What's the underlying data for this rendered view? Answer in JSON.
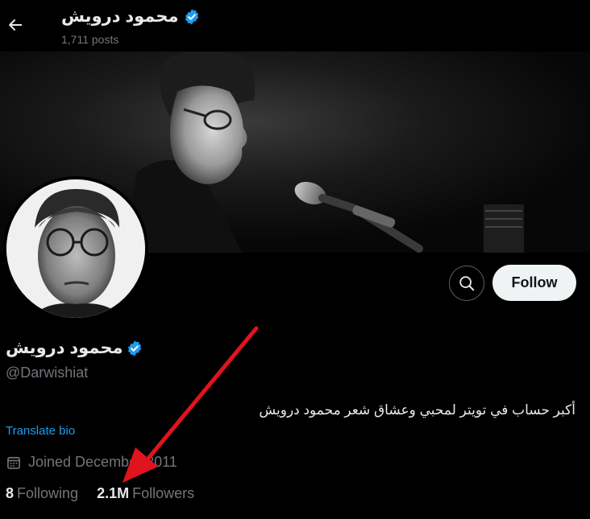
{
  "header": {
    "title": "محمود درويش",
    "posts": "1,711 posts"
  },
  "profile": {
    "name": "محمود درويش",
    "handle": "@Darwishiat",
    "bio": "أكبر حساب في تويتر لمحبي وعشاق شعر محمود درويش",
    "translate_label": "Translate bio",
    "joined": "Joined December 2011",
    "following_count": "8",
    "following_label": "Following",
    "followers_count": "2.1M",
    "followers_label": "Followers"
  },
  "actions": {
    "follow_label": "Follow"
  },
  "colors": {
    "verified": "#1d9bf0",
    "link": "#1d9bf0",
    "muted": "#71767b",
    "arrow": "#e0141e"
  },
  "icons": {
    "back": "arrow-left-icon",
    "verified": "verified-badge-icon",
    "search": "search-icon",
    "calendar": "calendar-icon"
  }
}
